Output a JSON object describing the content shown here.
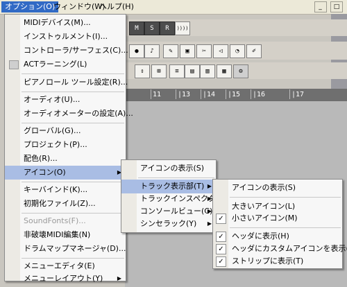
{
  "menubar": {
    "items": [
      {
        "label": "オプション(O)"
      },
      {
        "label": "ウィンドウ(W)"
      },
      {
        "label": "ヘルプ(H)"
      }
    ]
  },
  "window_controls": [
    "_",
    "□"
  ],
  "toolbar": {
    "row1": [
      "M",
      "S",
      "R",
      "))))"
    ]
  },
  "ruler": {
    "ticks": [
      "11",
      "|13",
      "|14",
      "|15",
      "|16",
      "|17"
    ]
  },
  "options_menu": {
    "items": [
      {
        "label": "MIDIデバイス(M)..."
      },
      {
        "label": "インストゥルメント(I)..."
      },
      {
        "label": "コントローラ/サーフェス(C)..."
      },
      {
        "label": "ACTラーニング(L)"
      },
      {
        "label": "ピアノロール ツール設定(R)..."
      },
      {
        "label": "オーディオ(U)..."
      },
      {
        "label": "オーディオメーターの設定(A)..."
      },
      {
        "label": "グローバル(G)..."
      },
      {
        "label": "プロジェクト(P)..."
      },
      {
        "label": "配色(R)..."
      },
      {
        "label": "アイコン(O)"
      },
      {
        "label": "キーバインド(K)..."
      },
      {
        "label": "初期化ファイル(Z)..."
      },
      {
        "label": "SoundFonts(F)..."
      },
      {
        "label": "非破壊MIDI編集(N)"
      },
      {
        "label": "ドラムマップマネージャ(D)..."
      },
      {
        "label": "メニューエディタ(E)"
      },
      {
        "label": "メニューレイアウト(Y)"
      }
    ]
  },
  "icons_submenu": {
    "items": [
      {
        "label": "アイコンの表示(S)"
      },
      {
        "label": "トラック表示部(T)"
      },
      {
        "label": "トラックインスペクタ(I)"
      },
      {
        "label": "コンソールビュー(C)"
      },
      {
        "label": "シンセラック(Y)"
      }
    ]
  },
  "track_submenu": {
    "items": [
      {
        "label": "アイコンの表示(S)"
      },
      {
        "label": "大きいアイコン(L)"
      },
      {
        "label": "小さいアイコン(M)"
      },
      {
        "label": "ヘッダに表示(H)"
      },
      {
        "label": "ヘッダにカスタムアイコンを表示(C)"
      },
      {
        "label": "ストリップに表示(T)"
      }
    ]
  },
  "glyphs": {
    "check": "✓",
    "submenu_arrow": "▶"
  },
  "colors": {
    "highlight": "#a9bde4",
    "menubar_active": "#316ac5"
  }
}
